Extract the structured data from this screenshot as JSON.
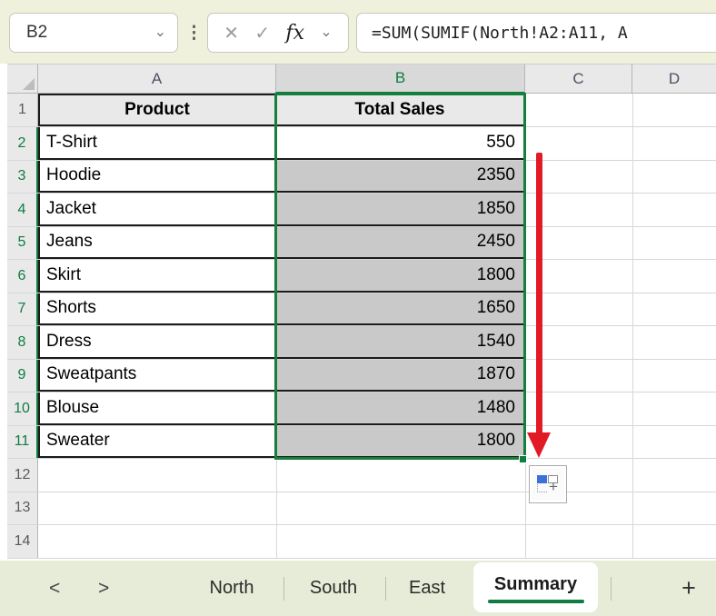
{
  "name_box": {
    "value": "B2",
    "dropdown_icon": "⌄"
  },
  "toolbar": {
    "dots_icon": "⋮",
    "cancel_icon": "✕",
    "enter_icon": "✓",
    "fx_label": "fx",
    "fx_dropdown_icon": "⌄"
  },
  "formula_bar": {
    "formula": "=SUM(SUMIF(North!A2:A11, A"
  },
  "grid": {
    "column_letters": [
      "A",
      "B",
      "C",
      "D"
    ],
    "selected_column": "B",
    "header_row": {
      "n": "1",
      "product": "Product",
      "sales": "Total Sales"
    },
    "rows": [
      {
        "n": "2",
        "product": "T-Shirt",
        "sales": "550"
      },
      {
        "n": "3",
        "product": "Hoodie",
        "sales": "2350"
      },
      {
        "n": "4",
        "product": "Jacket",
        "sales": "1850"
      },
      {
        "n": "5",
        "product": "Jeans",
        "sales": "2450"
      },
      {
        "n": "6",
        "product": "Skirt",
        "sales": "1800"
      },
      {
        "n": "7",
        "product": "Shorts",
        "sales": "1650"
      },
      {
        "n": "8",
        "product": "Dress",
        "sales": "1540"
      },
      {
        "n": "9",
        "product": "Sweatpants",
        "sales": "1870"
      },
      {
        "n": "10",
        "product": "Blouse",
        "sales": "1480"
      },
      {
        "n": "11",
        "product": "Sweater",
        "sales": "1800"
      }
    ],
    "empty_rows": [
      {
        "n": "12"
      },
      {
        "n": "13"
      },
      {
        "n": "14"
      }
    ]
  },
  "sheet_bar": {
    "prev_icon": "<",
    "next_icon": ">",
    "tabs": [
      {
        "label": "North"
      },
      {
        "label": "South"
      },
      {
        "label": "East"
      },
      {
        "label": "Summary"
      }
    ],
    "active_tab": "Summary",
    "add_icon": "+"
  },
  "colors": {
    "accent_green": "#107C41",
    "selection_fill": "#c9c9c9",
    "arrow_red": "#e11b25",
    "table_border": "#1b1b1b",
    "topbar_bg": "#eff1dc",
    "tabbar_bg": "#e6ecd8"
  }
}
